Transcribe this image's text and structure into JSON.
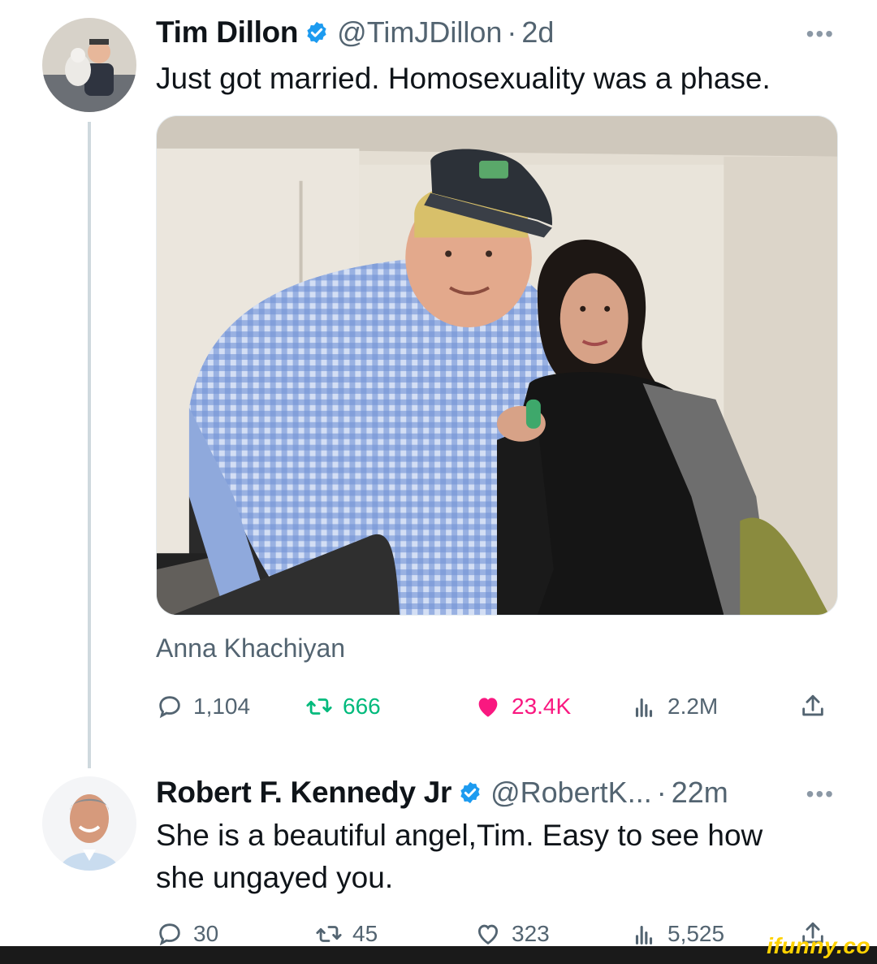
{
  "thread": {
    "main_tweet": {
      "author_name": "Tim Dillon",
      "handle": "@TimJDillon",
      "separator": "·",
      "time": "2d",
      "more_label": "•••",
      "text": "Just got married. Homosexuality was a phase.",
      "tagged_user": "Anna Khachiyan",
      "metrics": {
        "replies": "1,104",
        "retweets": "666",
        "likes": "23.4K",
        "views": "2.2M"
      },
      "liked": true
    },
    "reply_tweet": {
      "author_name": "Robert F. Kennedy Jr",
      "handle": "@RobertK...",
      "separator": "·",
      "time": "22m",
      "more_label": "•••",
      "text_line1": "She is a beautiful angel,Tim. Easy to see how",
      "text_line2": "she ungayed you.",
      "metrics": {
        "replies": "30",
        "retweets": "45",
        "likes": "323",
        "views": "5,525"
      },
      "liked": false
    }
  },
  "watermark": "ifunny.co",
  "colors": {
    "verified": "#1d9bf0",
    "retweet_active": "#00ba7c",
    "like_active": "#f91880",
    "muted": "#536471",
    "thread_line": "#cfd9de",
    "watermark": "#ffd200"
  },
  "icons": [
    "verified-badge-icon",
    "reply-icon",
    "retweet-icon",
    "like-icon",
    "views-icon",
    "share-icon",
    "more-icon"
  ]
}
